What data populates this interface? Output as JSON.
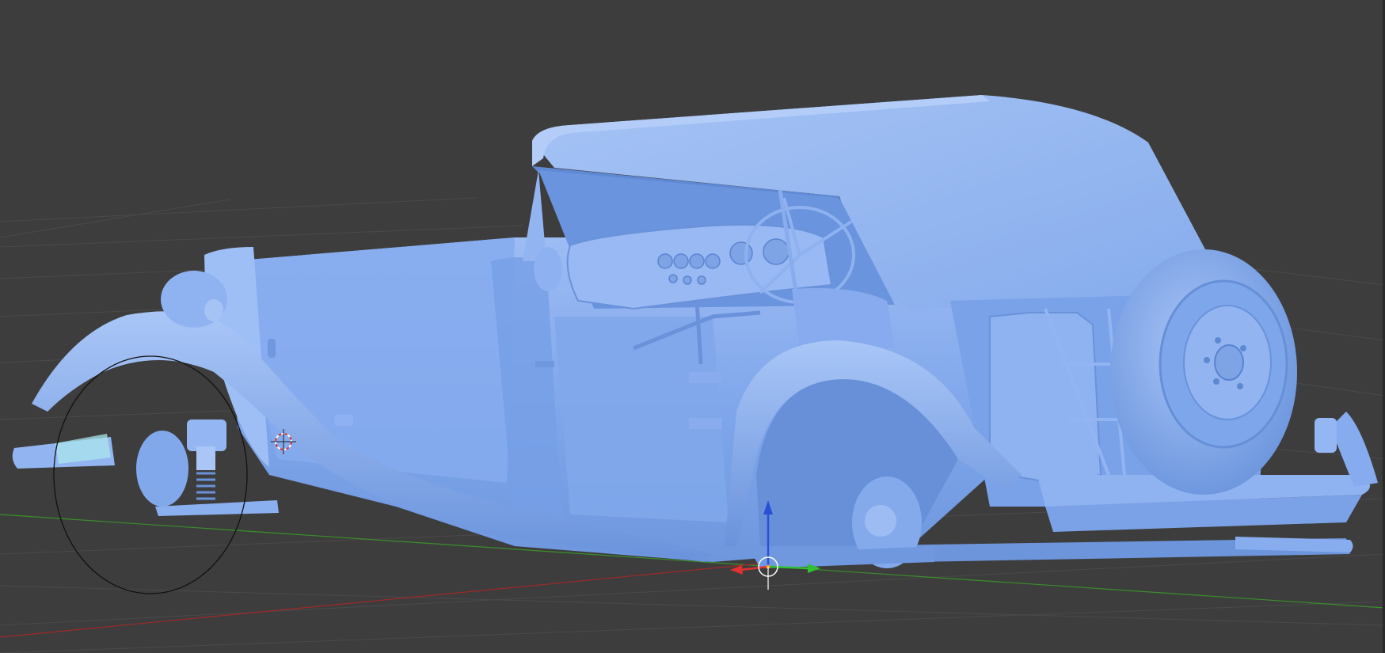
{
  "app": "3D viewport",
  "viewport": {
    "background": "#3d3d3d",
    "grid_color": "#494949",
    "axis_x_color": "#b02a2a",
    "axis_y_color": "#3a9a2a",
    "mode": "solid",
    "model": {
      "name": "vintage-roadster",
      "material_color": "#7ea6ea",
      "shadow_color": "#5a86d4",
      "highlight_color": "#a9c6f7"
    }
  },
  "gizmo": {
    "x_arrow_color": "#e03030",
    "y_arrow_color": "#30c030",
    "z_arrow_color": "#2a50d8"
  },
  "cursor_3d": {
    "ring_colors": [
      "#d23a3a",
      "#ffffff"
    ]
  },
  "brush_circle": {
    "stroke": "#111111"
  }
}
